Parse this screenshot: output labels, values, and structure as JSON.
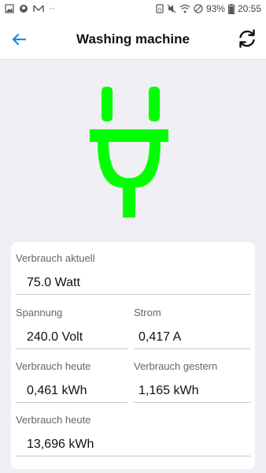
{
  "status_bar": {
    "battery": "93%",
    "time": "20:55",
    "dots": "··"
  },
  "header": {
    "title": "Washing machine"
  },
  "colors": {
    "accent": "#1e88e5",
    "plug": "#00ff00"
  },
  "icons": {
    "back": "arrow-left-icon",
    "refresh": "refresh-icon",
    "plug": "power-plug-icon"
  },
  "fields": {
    "current_usage": {
      "label": "Verbrauch aktuell",
      "value": "75.0 Watt"
    },
    "voltage": {
      "label": "Spannung",
      "value": "240.0 Volt"
    },
    "current": {
      "label": "Strom",
      "value": "0,417 A"
    },
    "usage_today": {
      "label": "Verbrauch heute",
      "value": "0,461 kWh"
    },
    "usage_yesterday": {
      "label": "Verbrauch gestern",
      "value": "1,165 kWh"
    },
    "usage_total": {
      "label": "Verbrauch heute",
      "value": "13,696 kWh"
    }
  }
}
